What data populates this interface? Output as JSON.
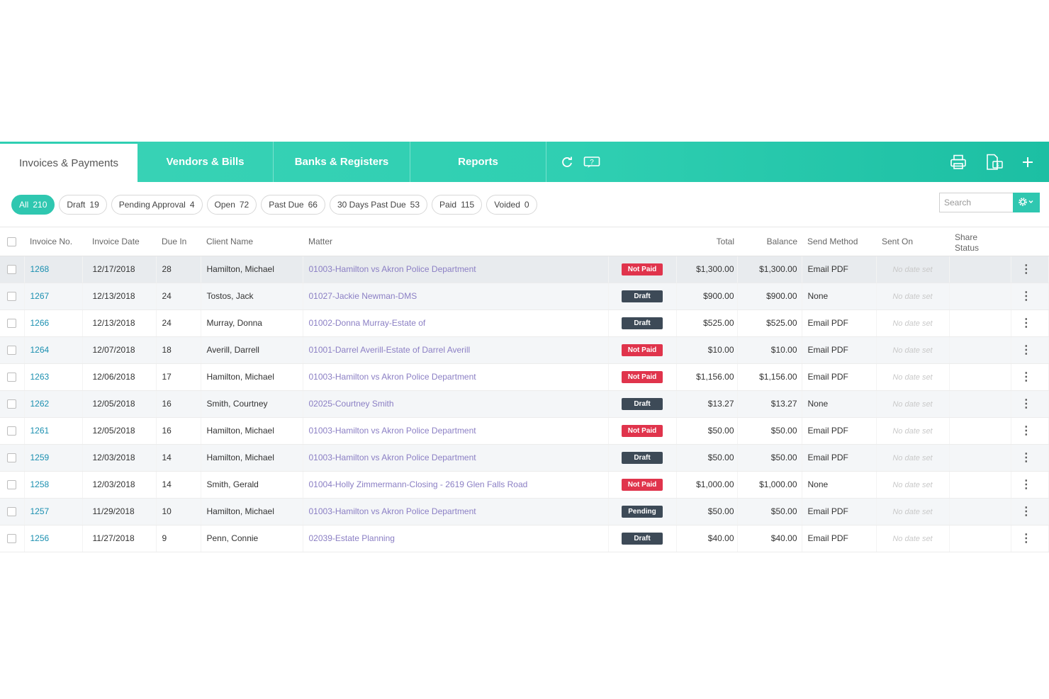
{
  "tabs": [
    {
      "label": "Invoices & Payments"
    },
    {
      "label": "Vendors & Bills"
    },
    {
      "label": "Banks & Registers"
    },
    {
      "label": "Reports"
    }
  ],
  "filters": [
    {
      "label": "All",
      "count": "210"
    },
    {
      "label": "Draft",
      "count": "19"
    },
    {
      "label": "Pending Approval",
      "count": "4"
    },
    {
      "label": "Open",
      "count": "72"
    },
    {
      "label": "Past Due",
      "count": "66"
    },
    {
      "label": "30 Days Past Due",
      "count": "53"
    },
    {
      "label": "Paid",
      "count": "115"
    },
    {
      "label": "Voided",
      "count": "0"
    }
  ],
  "search": {
    "placeholder": "Search"
  },
  "columns": {
    "invoice_no": "Invoice No.",
    "invoice_date": "Invoice Date",
    "due_in": "Due In",
    "client_name": "Client Name",
    "matter": "Matter",
    "total": "Total",
    "balance": "Balance",
    "send_method": "Send Method",
    "sent_on": "Sent On",
    "share_status_1": "Share",
    "share_status_2": "Status"
  },
  "rows": [
    {
      "no": "1268",
      "date": "12/17/2018",
      "due": "28",
      "client": "Hamilton, Michael",
      "matter": "01003-Hamilton vs Akron Police Department",
      "status": "Not Paid",
      "total": "$1,300.00",
      "balance": "$1,300.00",
      "send": "Email PDF",
      "sent_on": "No date set"
    },
    {
      "no": "1267",
      "date": "12/13/2018",
      "due": "24",
      "client": "Tostos, Jack",
      "matter": "01027-Jackie Newman-DMS",
      "status": "Draft",
      "total": "$900.00",
      "balance": "$900.00",
      "send": "None",
      "sent_on": "No date set"
    },
    {
      "no": "1266",
      "date": "12/13/2018",
      "due": "24",
      "client": "Murray, Donna",
      "matter": "01002-Donna Murray-Estate of",
      "status": "Draft",
      "total": "$525.00",
      "balance": "$525.00",
      "send": "Email PDF",
      "sent_on": "No date set"
    },
    {
      "no": "1264",
      "date": "12/07/2018",
      "due": "18",
      "client": "Averill, Darrell",
      "matter": "01001-Darrel Averill-Estate of Darrel Averill",
      "status": "Not Paid",
      "total": "$10.00",
      "balance": "$10.00",
      "send": "Email PDF",
      "sent_on": "No date set"
    },
    {
      "no": "1263",
      "date": "12/06/2018",
      "due": "17",
      "client": "Hamilton, Michael",
      "matter": "01003-Hamilton vs Akron Police Department",
      "status": "Not Paid",
      "total": "$1,156.00",
      "balance": "$1,156.00",
      "send": "Email PDF",
      "sent_on": "No date set"
    },
    {
      "no": "1262",
      "date": "12/05/2018",
      "due": "16",
      "client": "Smith, Courtney",
      "matter": "02025-Courtney Smith",
      "status": "Draft",
      "total": "$13.27",
      "balance": "$13.27",
      "send": "None",
      "sent_on": "No date set"
    },
    {
      "no": "1261",
      "date": "12/05/2018",
      "due": "16",
      "client": "Hamilton, Michael",
      "matter": "01003-Hamilton vs Akron Police Department",
      "status": "Not Paid",
      "total": "$50.00",
      "balance": "$50.00",
      "send": "Email PDF",
      "sent_on": "No date set"
    },
    {
      "no": "1259",
      "date": "12/03/2018",
      "due": "14",
      "client": "Hamilton, Michael",
      "matter": "01003-Hamilton vs Akron Police Department",
      "status": "Draft",
      "total": "$50.00",
      "balance": "$50.00",
      "send": "Email PDF",
      "sent_on": "No date set"
    },
    {
      "no": "1258",
      "date": "12/03/2018",
      "due": "14",
      "client": "Smith, Gerald",
      "matter": "01004-Holly Zimmermann-Closing - 2619 Glen Falls Road",
      "status": "Not Paid",
      "total": "$1,000.00",
      "balance": "$1,000.00",
      "send": "None",
      "sent_on": "No date set"
    },
    {
      "no": "1257",
      "date": "11/29/2018",
      "due": "10",
      "client": "Hamilton, Michael",
      "matter": "01003-Hamilton vs Akron Police Department",
      "status": "Pending",
      "total": "$50.00",
      "balance": "$50.00",
      "send": "Email PDF",
      "sent_on": "No date set"
    },
    {
      "no": "1256",
      "date": "11/27/2018",
      "due": "9",
      "client": "Penn, Connie",
      "matter": "02039-Estate Planning",
      "status": "Draft",
      "total": "$40.00",
      "balance": "$40.00",
      "send": "Email PDF",
      "sent_on": "No date set"
    }
  ],
  "colors": {
    "accent": "#2fc7b0",
    "not_paid": "#e0344c",
    "draft": "#3d4a57",
    "link": "#1a8fb0",
    "matter_link": "#8b7fc4"
  },
  "icons": {
    "refresh": "refresh-icon",
    "help": "help-icon",
    "print": "print-icon",
    "export": "export-icon",
    "add": "plus-icon",
    "settings": "gear-icon",
    "row_menu": "kebab-menu-icon"
  }
}
